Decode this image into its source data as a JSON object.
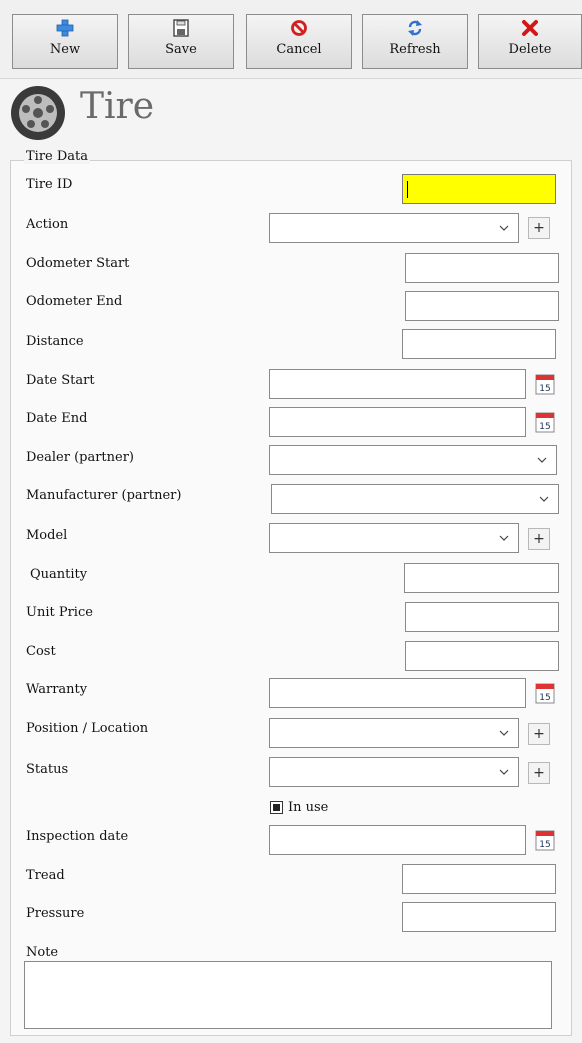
{
  "toolbar": {
    "new": "New",
    "save": "Save",
    "cancel": "Cancel",
    "refresh": "Refresh",
    "delete": "Delete"
  },
  "header": {
    "title": "Tire",
    "icon": "tire-icon"
  },
  "group": {
    "legend": "Tire Data"
  },
  "fields": {
    "tire_id": "Tire ID",
    "action": "Action",
    "odometer_start": "Odometer Start",
    "odometer_end": "Odometer End",
    "distance": "Distance",
    "date_start": "Date Start",
    "date_end": "Date End",
    "dealer": "Dealer (partner)",
    "manufacturer": "Manufacturer (partner)",
    "model": "Model",
    "quantity": "Quantity",
    "unit_price": "Unit Price",
    "cost": "Cost",
    "warranty": "Warranty",
    "position": "Position / Location",
    "status": "Status",
    "in_use": "In use",
    "inspection_date": "Inspection date",
    "tread": "Tread",
    "pressure": "Pressure",
    "note": "Note"
  },
  "calendar_day": "15",
  "colors": {
    "tire_id_bg": "#ffff00",
    "new_icon": "#2f7fd1",
    "cancel_icon": "#d22020",
    "refresh_icon": "#2f6fcf",
    "delete_icon": "#d01818"
  }
}
